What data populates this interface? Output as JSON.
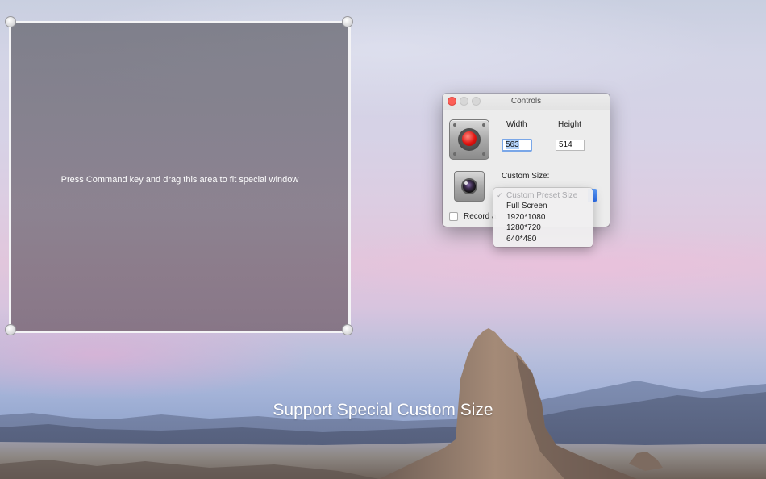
{
  "capture_area": {
    "hint": "Press Command key and drag this area to fit special window"
  },
  "controls": {
    "window_title": "Controls",
    "width_label": "Width",
    "height_label": "Height",
    "width_value": "563",
    "height_value": "514",
    "custom_size_label": "Custom Size:",
    "record_checkbox_label": "Record a",
    "record_checkbox_checked": false,
    "record_button_icon": "record-icon",
    "camera_button_icon": "camera-icon"
  },
  "preset_menu": {
    "checkmark": "✓",
    "items": [
      {
        "label": "Custom Preset Size",
        "disabled": true,
        "checked": true
      },
      {
        "label": "Full Screen",
        "disabled": false,
        "checked": false
      },
      {
        "label": "1920*1080",
        "disabled": false,
        "checked": false
      },
      {
        "label": "1280*720",
        "disabled": false,
        "checked": false
      },
      {
        "label": "640*480",
        "disabled": false,
        "checked": false
      }
    ]
  },
  "caption": "Support Special Custom Size",
  "colors": {
    "record_red": "#e0130f",
    "close_red": "#fc5f57",
    "accent_blue": "#2c6ff0"
  }
}
